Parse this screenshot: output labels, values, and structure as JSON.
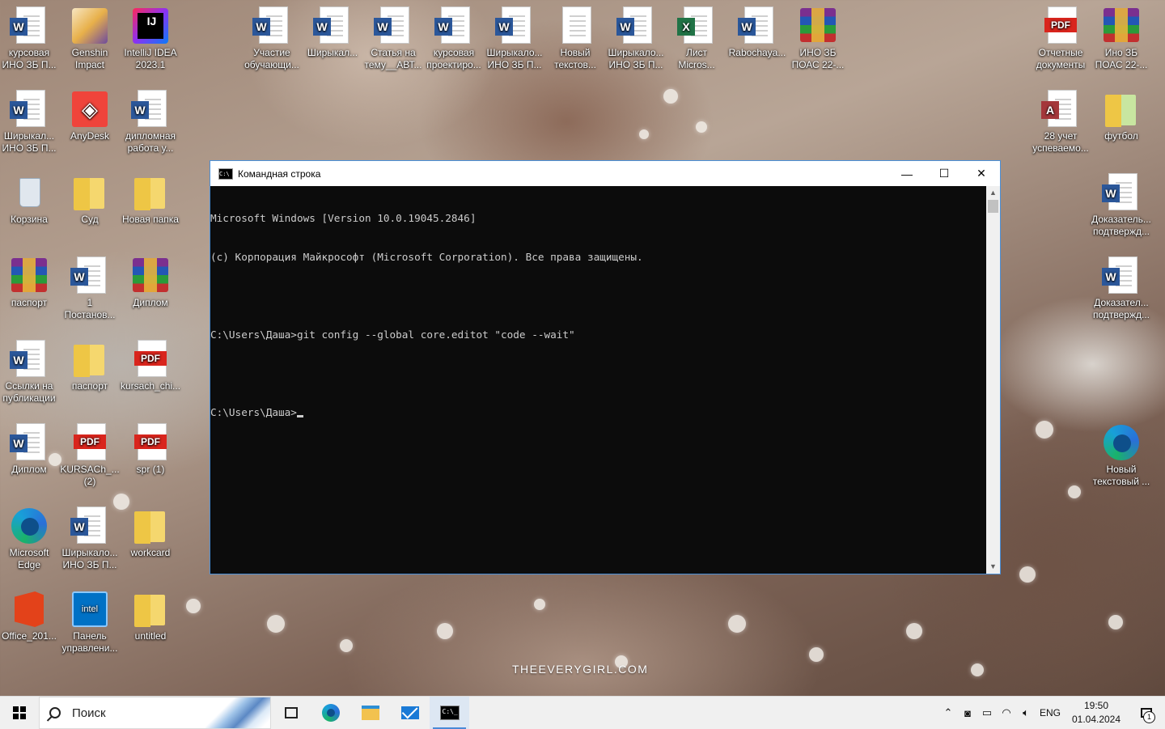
{
  "desktop": {
    "icons_left": [
      {
        "label": "курсовая\nИНО ЗБ П...",
        "type": "word"
      },
      {
        "label": "Genshin\nImpact",
        "type": "game"
      },
      {
        "label": "IntelliJ IDEA\n2023.1",
        "type": "idea"
      },
      {
        "label": "Ширыкал...\nИНО ЗБ П...",
        "type": "word"
      },
      {
        "label": "AnyDesk",
        "type": "anydesk"
      },
      {
        "label": "дипломная\nработа у...",
        "type": "word"
      },
      {
        "label": "Корзина",
        "type": "recycle"
      },
      {
        "label": "Суд",
        "type": "folder"
      },
      {
        "label": "Новая папка",
        "type": "folder"
      },
      {
        "label": "паспорт",
        "type": "rar"
      },
      {
        "label": "1\nПостанов...",
        "type": "word"
      },
      {
        "label": "Диплом",
        "type": "rar"
      },
      {
        "label": "Ссылки на\nпубликации",
        "type": "word"
      },
      {
        "label": "паспорт",
        "type": "folder"
      },
      {
        "label": "kursach_chi...",
        "type": "pdf"
      },
      {
        "label": "Диплом",
        "type": "word"
      },
      {
        "label": "KURSACh_...\n(2)",
        "type": "pdf"
      },
      {
        "label": "spr (1)",
        "type": "pdf"
      },
      {
        "label": "Microsoft\nEdge",
        "type": "edge"
      },
      {
        "label": "Ширыкало...\nИНО ЗБ П...",
        "type": "word"
      },
      {
        "label": "workcard",
        "type": "folder"
      },
      {
        "label": "Office_201...",
        "type": "office"
      },
      {
        "label": "Панель\nуправлени...",
        "type": "intel"
      },
      {
        "label": "untitled",
        "type": "folder"
      }
    ],
    "icons_top": [
      {
        "label": "Участие\nобучающи...",
        "type": "word"
      },
      {
        "label": "Ширыкал...",
        "type": "word"
      },
      {
        "label": "Статья на\nтему__АВТ...",
        "type": "word"
      },
      {
        "label": "курсовая\nпроектиро...",
        "type": "word"
      },
      {
        "label": "Ширыкало...\nИНО ЗБ П...",
        "type": "word"
      },
      {
        "label": "Новый\nтекстов...",
        "type": "txt"
      },
      {
        "label": "Ширыкало...\nИНО ЗБ П...",
        "type": "word"
      },
      {
        "label": "Лист\nMicros...",
        "type": "excel"
      },
      {
        "label": "Rabochaya...",
        "type": "word"
      },
      {
        "label": "ИНО ЗБ\nПОАС 22-...",
        "type": "rar"
      }
    ],
    "icons_right": [
      {
        "label": "Отчетные\nдокументы",
        "type": "pdf"
      },
      {
        "label": "Ино ЗБ\nПОАС 22-...",
        "type": "rar"
      },
      {
        "label": "28 учет\nуспеваемо...",
        "type": "access"
      },
      {
        "label": "футбол",
        "type": "folder-blue"
      },
      {
        "label": "Доказатель...\nподтвержд...",
        "type": "word"
      },
      {
        "label": "Доказател...\nподтвержд...",
        "type": "word"
      },
      {
        "label": "Новый\nтекстовый ...",
        "type": "edge"
      }
    ],
    "watermark": "THEEVERYGIRL.COM"
  },
  "cmd": {
    "title": "Командная строка",
    "lines": [
      "Microsoft Windows [Version 10.0.19045.2846]",
      "(c) Корпорация Майкрософт (Microsoft Corporation). Все права защищены.",
      "",
      "C:\\Users\\Даша>git config --global core.editot \"code --wait\"",
      "",
      "C:\\Users\\Даша>"
    ],
    "minimize": "—",
    "maximize": "☐",
    "close": "✕"
  },
  "taskbar": {
    "search_placeholder": "Поиск",
    "lang": "ENG",
    "time": "19:50",
    "date": "01.04.2024",
    "notification_count": "1"
  }
}
